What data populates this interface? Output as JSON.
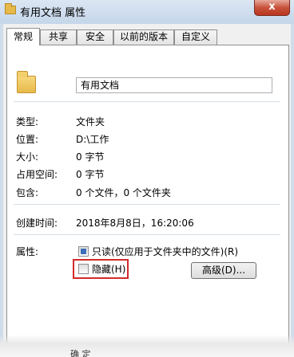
{
  "window": {
    "title": "有用文档 属性",
    "close_label": "x"
  },
  "tabs": [
    {
      "label": "常规",
      "active": true
    },
    {
      "label": "共享",
      "active": false
    },
    {
      "label": "安全",
      "active": false
    },
    {
      "label": "以前的版本",
      "active": false
    },
    {
      "label": "自定义",
      "active": false
    }
  ],
  "general": {
    "name_value": "有用文档",
    "type_label": "类型:",
    "type_value": "文件夹",
    "location_label": "位置:",
    "location_value": "D:\\工作",
    "size_label": "大小:",
    "size_value": "0 字节",
    "disk_label": "占用空间:",
    "disk_value": "0 字节",
    "contains_label": "包含:",
    "contains_value": "0 个文件，0 个文件夹",
    "created_label": "创建时间:",
    "created_value": "2018年8月8日，16:20:06",
    "attributes_label": "属性:",
    "readonly_label": "只读(仅应用于文件夹中的文件)(R)",
    "hidden_label": "隐藏(H)",
    "advanced_button": "高级(D)...",
    "partial_text": "确 定"
  },
  "icons": {
    "title": "folder-icon",
    "big": "folder-icon"
  },
  "colors": {
    "highlight": "#d22b2b",
    "folder": "#e7b94a",
    "checkbox_fill": "#3c6fb7"
  }
}
